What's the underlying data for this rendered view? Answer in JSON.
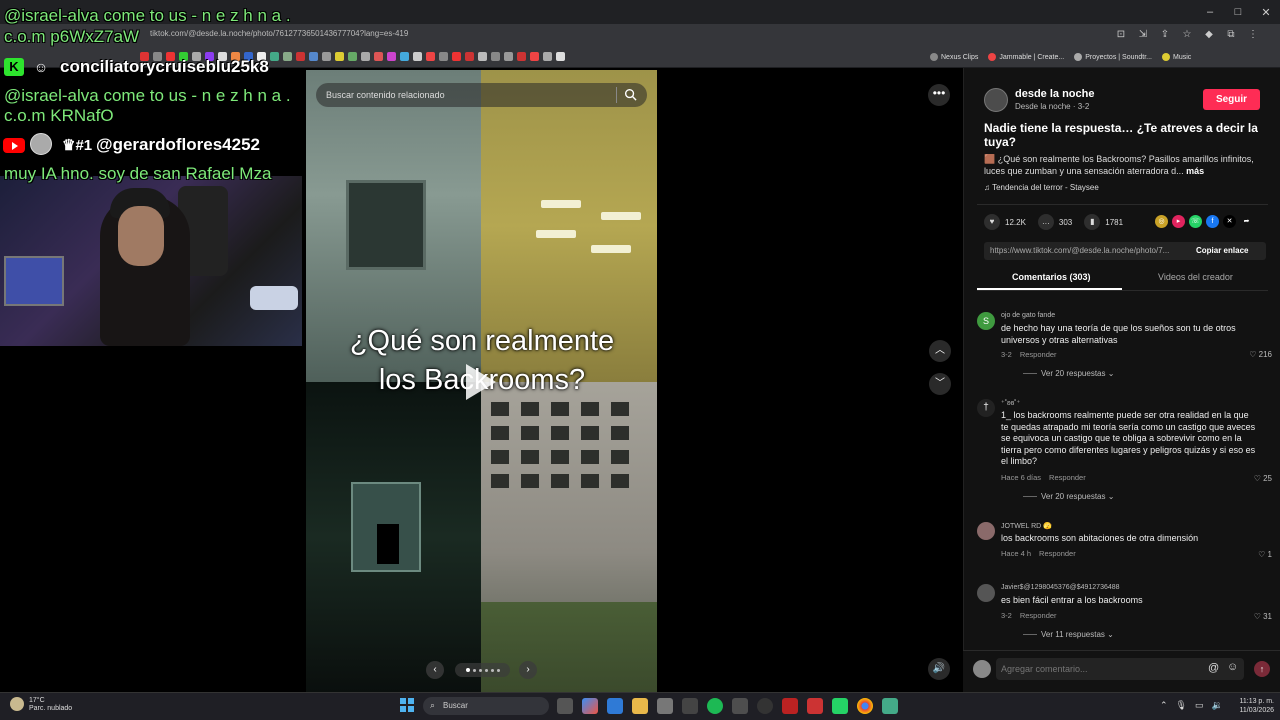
{
  "browser": {
    "url": "tiktok.com/@desde.la.noche/photo/7612773650143677704?lang=es-419",
    "window_controls": [
      "–",
      "□",
      "✕"
    ],
    "bookmarks": [
      "Nexus Clips",
      "Jammable | Create...",
      "Proyectos | Soundtr...",
      "Music"
    ]
  },
  "overlay": {
    "chat_line_1": "@israel-alva come to us - n e z h n a .",
    "chat_line_1b": "c.o.m p6WxZ7aW",
    "kick_user": "conciliatorycruiseblu25k8",
    "chat_line_2": "@israel-alva come to us - n e z h n a .",
    "chat_line_2b": "c.o.m KRNafO",
    "yt_badge": "#1",
    "yt_user": "@gerardoflores4252",
    "yt_message": "muy IA hno. soy de san Rafael Mza"
  },
  "video": {
    "search_placeholder": "Buscar contenido relacionado",
    "caption": "¿Qué son realmente los Backrooms?",
    "slide_count": 6,
    "active_slide": 1
  },
  "post": {
    "author": "desde la noche",
    "author_handle": "Desde la noche",
    "date": "3-2",
    "follow_label": "Seguir",
    "title": "Nadie tiene la respuesta… ¿Te atreves a decir la tuya?",
    "description": "🟫 ¿Qué son realmente los Backrooms? Pasillos amarillos infinitos, luces que zumban y una sensación aterradora d...",
    "more_label": "más",
    "music": "♫ Tendencia del terror - Staysee",
    "likes": "12.2K",
    "comments": "303",
    "saves": "1781",
    "link": "https://www.tiktok.com/@desde.la.noche/photo/7...",
    "copy_label": "Copiar enlace",
    "tab_comments": "Comentarios (303)",
    "tab_videos": "Videos del creador"
  },
  "comments": [
    {
      "name": "ojo de gato fande",
      "text": "de hecho hay una teoría de que los sueños son tu de otros universos y otras alternativas",
      "date": "3-2",
      "reply": "Responder",
      "likes": "216",
      "replies": "Ver 20 respuestas ⌄",
      "avatar_color": "#3f9a3f"
    },
    {
      "name": "⁺˚ʚɞ˚⁺",
      "text": "1_ los backrooms realmente puede ser otra realidad en la que te quedas atrapado mi teoría sería como un castigo que aveces se equivoca un castigo que te obliga a sobrevivir como en la tierra pero como diferentes lugares y peligros quizás y si eso es el limbo?",
      "date": "Hace 6 días",
      "reply": "Responder",
      "likes": "25",
      "replies": "Ver 20 respuestas ⌄",
      "avatar_color": "#222222"
    },
    {
      "name": "JOTWEL RD 🫣",
      "text": "los backrooms son abitaciones de otra dimensión",
      "date": "Hace 4 h",
      "reply": "Responder",
      "likes": "1",
      "replies": "",
      "avatar_color": "#8a6a6a"
    },
    {
      "name": "Javier$@1298045376@$4912736488",
      "text": "es bien fácil entrar a los backrooms",
      "date": "3-2",
      "reply": "Responder",
      "likes": "31",
      "replies": "Ver 11 respuestas ⌄",
      "avatar_color": "#555555"
    }
  ],
  "add_comment_placeholder": "Agregar comentario...",
  "taskbar": {
    "temp": "17°C",
    "weather": "Parc. nublado",
    "search": "Buscar",
    "time": "11:13 p. m.",
    "date": "11/03/2026"
  },
  "colors": {
    "follow": "#fe2c55",
    "chat_green": "#7ee97a",
    "kick_green": "#2ee42e",
    "panel_bg": "#121212"
  }
}
